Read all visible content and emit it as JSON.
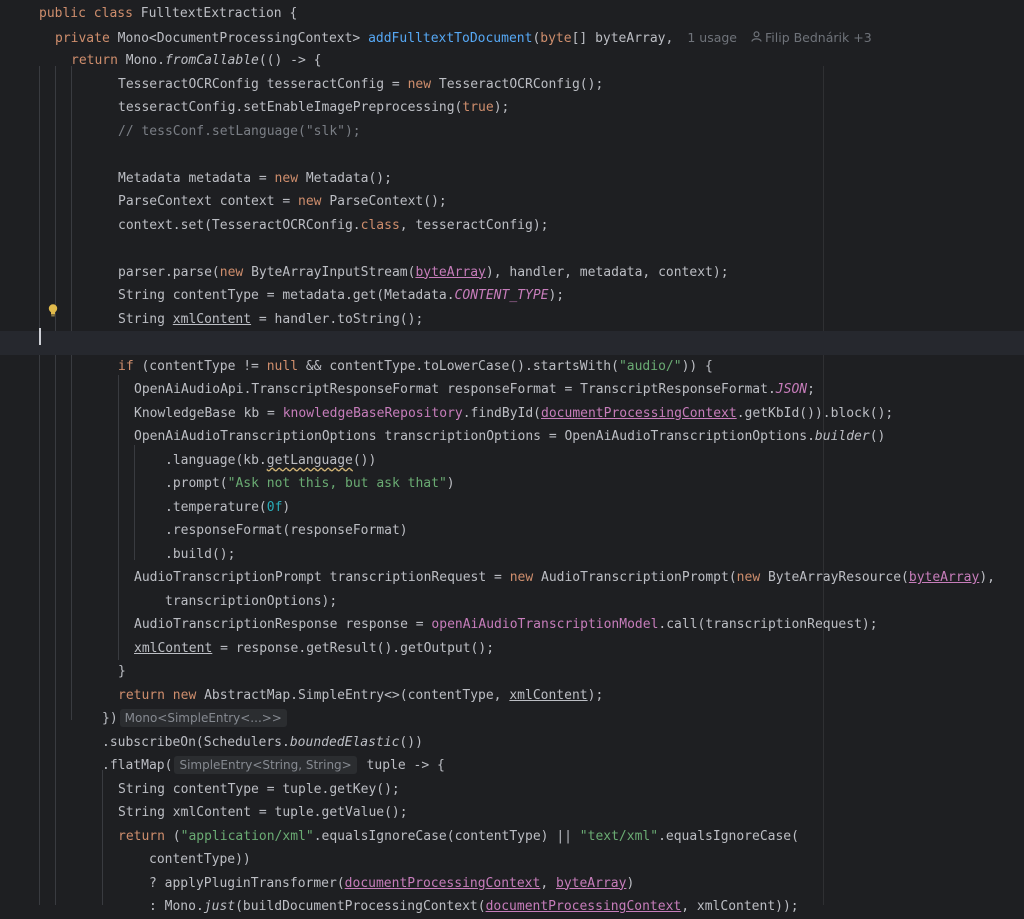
{
  "editor": {
    "lines": [
      {
        "indent": 39,
        "tokens": [
          {
            "c": "kw",
            "t": "public class "
          },
          {
            "c": "",
            "t": "FulltextExtraction {"
          }
        ]
      },
      {
        "indent": 55,
        "tokens": [
          {
            "c": "kw",
            "t": "private "
          },
          {
            "c": "",
            "t": "Mono<DocumentProcessingContext> "
          },
          {
            "c": "fn",
            "t": "addFulltextToDocument"
          },
          {
            "c": "",
            "t": "("
          },
          {
            "c": "kw",
            "t": "byte"
          },
          {
            "c": "",
            "t": "[] byteArray,"
          }
        ],
        "meta": true
      },
      {
        "indent": 71,
        "tokens": [
          {
            "c": "kw",
            "t": "return "
          },
          {
            "c": "",
            "t": "Mono."
          },
          {
            "c": "ital",
            "t": "fromCallable"
          },
          {
            "c": "",
            "t": "(() -> {"
          }
        ]
      },
      {
        "indent": 118,
        "tokens": [
          {
            "c": "",
            "t": "TesseractOCRConfig tesseractConfig = "
          },
          {
            "c": "kw",
            "t": "new "
          },
          {
            "c": "",
            "t": "TesseractOCRConfig();"
          }
        ]
      },
      {
        "indent": 118,
        "tokens": [
          {
            "c": "",
            "t": "tesseractConfig.setEnableImagePreprocessing("
          },
          {
            "c": "kw",
            "t": "true"
          },
          {
            "c": "",
            "t": ");"
          }
        ]
      },
      {
        "indent": 118,
        "tokens": [
          {
            "c": "cmt",
            "t": "// tessConf.setLanguage(\"slk\");"
          }
        ]
      },
      {
        "indent": 118,
        "tokens": []
      },
      {
        "indent": 118,
        "tokens": [
          {
            "c": "",
            "t": "Metadata metadata = "
          },
          {
            "c": "kw",
            "t": "new "
          },
          {
            "c": "",
            "t": "Metadata();"
          }
        ]
      },
      {
        "indent": 118,
        "tokens": [
          {
            "c": "",
            "t": "ParseContext context = "
          },
          {
            "c": "kw",
            "t": "new "
          },
          {
            "c": "",
            "t": "ParseContext();"
          }
        ]
      },
      {
        "indent": 118,
        "tokens": [
          {
            "c": "",
            "t": "context.set(TesseractOCRConfig."
          },
          {
            "c": "kw",
            "t": "class"
          },
          {
            "c": "",
            "t": ", tesseractConfig);"
          }
        ]
      },
      {
        "indent": 118,
        "tokens": []
      },
      {
        "indent": 118,
        "tokens": [
          {
            "c": "",
            "t": "parser.parse("
          },
          {
            "c": "kw",
            "t": "new "
          },
          {
            "c": "",
            "t": "ByteArrayInputStream("
          },
          {
            "c": "ul-field",
            "t": "byteArray"
          },
          {
            "c": "",
            "t": "), handler, metadata, context);"
          }
        ]
      },
      {
        "indent": 118,
        "tokens": [
          {
            "c": "",
            "t": "String contentType = metadata.get(Metadata."
          },
          {
            "c": "const",
            "t": "CONTENT_TYPE"
          },
          {
            "c": "",
            "t": ");"
          }
        ]
      },
      {
        "indent": 118,
        "tokens": [
          {
            "c": "",
            "t": "String "
          },
          {
            "c": "ul",
            "t": "xmlContent"
          },
          {
            "c": "",
            "t": " = handler.toString();"
          }
        ]
      },
      {
        "indent": 118,
        "tokens": [],
        "current": true
      },
      {
        "indent": 118,
        "tokens": [
          {
            "c": "kw",
            "t": "if "
          },
          {
            "c": "",
            "t": "(contentType != "
          },
          {
            "c": "kw",
            "t": "null "
          },
          {
            "c": "",
            "t": "&& contentType.toLowerCase().startsWith("
          },
          {
            "c": "str",
            "t": "\"audio/\""
          },
          {
            "c": "",
            "t": ")) {"
          }
        ]
      },
      {
        "indent": 134,
        "tokens": [
          {
            "c": "",
            "t": "OpenAiAudioApi.TranscriptResponseFormat responseFormat = TranscriptResponseFormat."
          },
          {
            "c": "const",
            "t": "JSON"
          },
          {
            "c": "",
            "t": ";"
          }
        ]
      },
      {
        "indent": 134,
        "tokens": [
          {
            "c": "",
            "t": "KnowledgeBase kb = "
          },
          {
            "c": "field",
            "t": "knowledgeBaseRepository"
          },
          {
            "c": "",
            "t": ".findById("
          },
          {
            "c": "ul-field",
            "t": "documentProcessingContext"
          },
          {
            "c": "",
            "t": ".getKbId()).block();"
          }
        ]
      },
      {
        "indent": 134,
        "tokens": [
          {
            "c": "",
            "t": "OpenAiAudioTranscriptionOptions transcriptionOptions = OpenAiAudioTranscriptionOptions."
          },
          {
            "c": "ital",
            "t": "builder"
          },
          {
            "c": "",
            "t": "()"
          }
        ]
      },
      {
        "indent": 165,
        "tokens": [
          {
            "c": "",
            "t": ".language(kb."
          },
          {
            "c": "squig",
            "t": "getLanguage"
          },
          {
            "c": "",
            "t": "())"
          }
        ]
      },
      {
        "indent": 165,
        "tokens": [
          {
            "c": "",
            "t": ".prompt("
          },
          {
            "c": "str",
            "t": "\"Ask not this, but ask that\""
          },
          {
            "c": "",
            "t": ")"
          }
        ]
      },
      {
        "indent": 165,
        "tokens": [
          {
            "c": "",
            "t": ".temperature("
          },
          {
            "c": "num",
            "t": "0f"
          },
          {
            "c": "",
            "t": ")"
          }
        ]
      },
      {
        "indent": 165,
        "tokens": [
          {
            "c": "",
            "t": ".responseFormat(responseFormat)"
          }
        ]
      },
      {
        "indent": 165,
        "tokens": [
          {
            "c": "",
            "t": ".build();"
          }
        ]
      },
      {
        "indent": 134,
        "tokens": [
          {
            "c": "",
            "t": "AudioTranscriptionPrompt transcriptionRequest = "
          },
          {
            "c": "kw",
            "t": "new "
          },
          {
            "c": "",
            "t": "AudioTranscriptionPrompt("
          },
          {
            "c": "kw",
            "t": "new "
          },
          {
            "c": "",
            "t": "ByteArrayResource("
          },
          {
            "c": "ul-field",
            "t": "byteArray"
          },
          {
            "c": "",
            "t": "),"
          }
        ]
      },
      {
        "indent": 165,
        "tokens": [
          {
            "c": "",
            "t": "transcriptionOptions);"
          }
        ]
      },
      {
        "indent": 134,
        "tokens": [
          {
            "c": "",
            "t": "AudioTranscriptionResponse response = "
          },
          {
            "c": "field",
            "t": "openAiAudioTranscriptionModel"
          },
          {
            "c": "",
            "t": ".call(transcriptionRequest);"
          }
        ]
      },
      {
        "indent": 134,
        "tokens": [
          {
            "c": "ul",
            "t": "xmlContent"
          },
          {
            "c": "",
            "t": " = response.getResult().getOutput();"
          }
        ]
      },
      {
        "indent": 118,
        "tokens": [
          {
            "c": "",
            "t": "}"
          }
        ]
      },
      {
        "indent": 118,
        "tokens": [
          {
            "c": "kw",
            "t": "return new "
          },
          {
            "c": "",
            "t": "AbstractMap.SimpleEntry<>(contentType, "
          },
          {
            "c": "ul",
            "t": "xmlContent"
          },
          {
            "c": "",
            "t": ");"
          }
        ]
      },
      {
        "indent": 102,
        "tokens": [
          {
            "c": "",
            "t": "})"
          }
        ],
        "hint": "Mono<SimpleEntry<...>>"
      },
      {
        "indent": 102,
        "tokens": [
          {
            "c": "",
            "t": ".subscribeOn(Schedulers."
          },
          {
            "c": "ital",
            "t": "boundedElastic"
          },
          {
            "c": "",
            "t": "())"
          }
        ]
      },
      {
        "indent": 102,
        "tokens": [
          {
            "c": "",
            "t": ".flatMap("
          }
        ],
        "hint": "SimpleEntry<String, String>",
        "after": " tuple -> {"
      },
      {
        "indent": 118,
        "tokens": [
          {
            "c": "",
            "t": "String contentType = tuple.getKey();"
          }
        ]
      },
      {
        "indent": 118,
        "tokens": [
          {
            "c": "",
            "t": "String xmlContent = tuple.getValue();"
          }
        ]
      },
      {
        "indent": 118,
        "tokens": [
          {
            "c": "kw",
            "t": "return "
          },
          {
            "c": "",
            "t": "("
          },
          {
            "c": "str",
            "t": "\"application/xml\""
          },
          {
            "c": "",
            "t": ".equalsIgnoreCase(contentType) || "
          },
          {
            "c": "str",
            "t": "\"text/xml\""
          },
          {
            "c": "",
            "t": ".equalsIgnoreCase("
          }
        ]
      },
      {
        "indent": 149,
        "tokens": [
          {
            "c": "",
            "t": "contentType))"
          }
        ]
      },
      {
        "indent": 149,
        "tokens": [
          {
            "c": "",
            "t": "? applyPluginTransformer("
          },
          {
            "c": "ul-field",
            "t": "documentProcessingContext"
          },
          {
            "c": "",
            "t": ", "
          },
          {
            "c": "ul-field",
            "t": "byteArray"
          },
          {
            "c": "",
            "t": ")"
          }
        ]
      },
      {
        "indent": 149,
        "tokens": [
          {
            "c": "",
            "t": ": Mono."
          },
          {
            "c": "ital",
            "t": "just"
          },
          {
            "c": "",
            "t": "(buildDocumentProcessingContext("
          },
          {
            "c": "ul-field",
            "t": "documentProcessingContext"
          },
          {
            "c": "",
            "t": ", xmlContent));"
          }
        ]
      }
    ],
    "method_usages": "1 usage",
    "method_authors": "Filip Bednárik +3",
    "user_icon": "user-icon",
    "bulb_icon": "lightbulb-icon"
  }
}
